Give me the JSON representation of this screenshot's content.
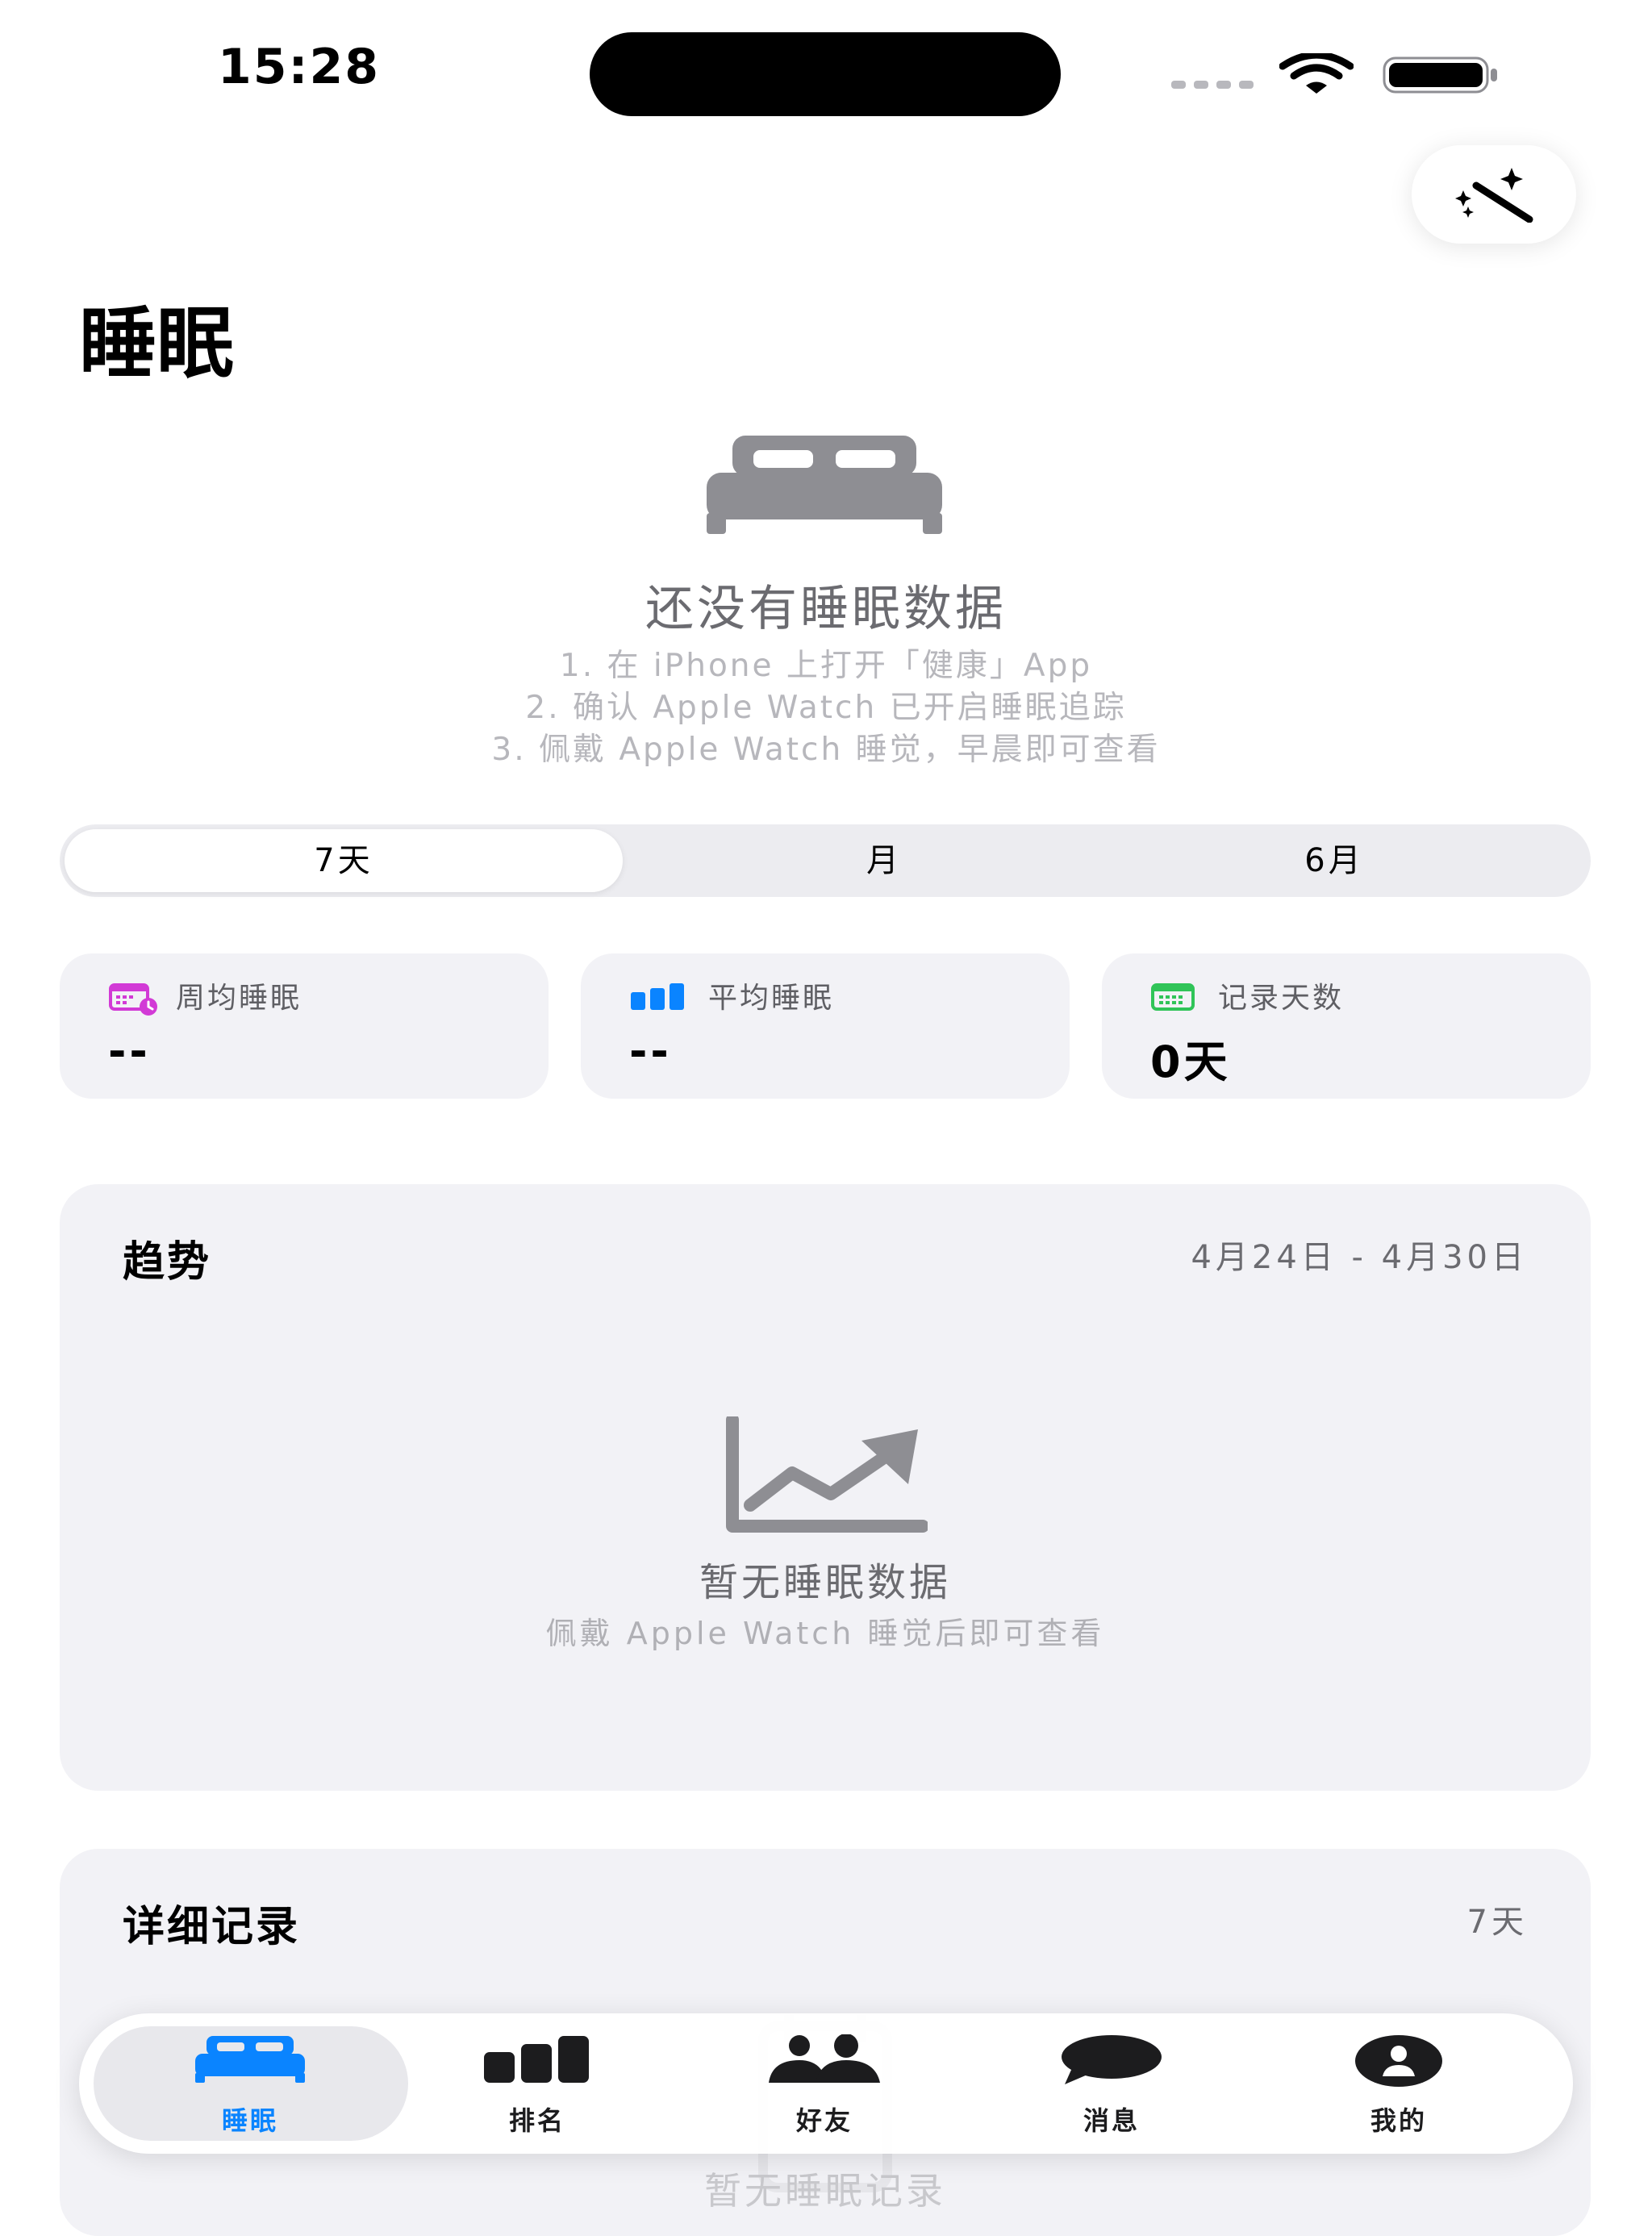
{
  "status_bar": {
    "time": "15:28"
  },
  "header": {
    "title": "睡眠",
    "magic_icon": "magic-wand-icon"
  },
  "empty_state": {
    "icon": "bed-icon",
    "title": "还没有睡眠数据",
    "steps": [
      "1. 在 iPhone 上打开「健康」App",
      "2. 确认 Apple Watch 已开启睡眠追踪",
      "3. 佩戴 Apple Watch 睡觉，早晨即可查看"
    ]
  },
  "range_selector": {
    "options": [
      "7天",
      "月",
      "6月"
    ],
    "selected": "7天"
  },
  "stats": [
    {
      "label": "周均睡眠",
      "value": "--",
      "icon": "calendar-clock-icon",
      "color": "#d23ad6"
    },
    {
      "label": "平均睡眠",
      "value": "--",
      "icon": "chart-bars-icon",
      "color": "#0a84ff"
    },
    {
      "label": "记录天数",
      "value": "0天",
      "icon": "calendar-icon",
      "color": "#30c458"
    }
  ],
  "trend": {
    "title": "趋势",
    "date_range": "4月24日 - 4月30日",
    "empty_title": "暂无睡眠数据",
    "empty_subtitle": "佩戴 Apple Watch 睡觉后即可查看"
  },
  "detail": {
    "title": "详细记录",
    "range": "7天",
    "empty_title": "暂无睡眠记录"
  },
  "tabbar": {
    "active": "睡眠",
    "active_color": "#0a84ff",
    "items": [
      {
        "label": "睡眠",
        "icon": "bed-icon"
      },
      {
        "label": "排名",
        "icon": "chart-bars-icon"
      },
      {
        "label": "好友",
        "icon": "people-icon"
      },
      {
        "label": "消息",
        "icon": "chat-bubble-icon"
      },
      {
        "label": "我的",
        "icon": "person-circle-icon"
      }
    ]
  }
}
